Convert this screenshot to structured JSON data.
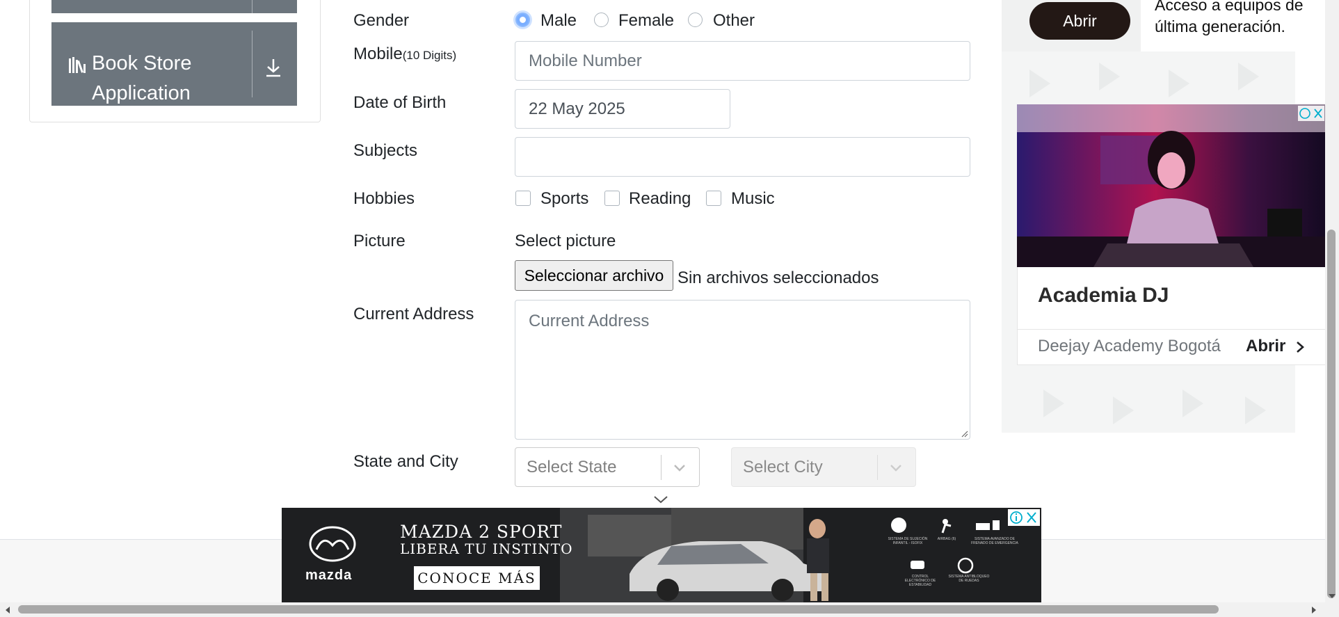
{
  "sidebar": {
    "book_store_label": "Book Store Application"
  },
  "form": {
    "gender": {
      "label": "Gender",
      "options": [
        "Male",
        "Female",
        "Other"
      ],
      "selected": "Male"
    },
    "mobile": {
      "label": "Mobile",
      "hint": "(10 Digits)",
      "placeholder": "Mobile Number",
      "value": ""
    },
    "dob": {
      "label": "Date of Birth",
      "value": "22 May 2025"
    },
    "subjects": {
      "label": "Subjects",
      "value": ""
    },
    "hobbies": {
      "label": "Hobbies",
      "options": [
        "Sports",
        "Reading",
        "Music"
      ],
      "checked": []
    },
    "picture": {
      "label": "Picture",
      "select_text": "Select picture",
      "button_label": "Seleccionar archivo",
      "no_file_text": "Sin archivos seleccionados"
    },
    "address": {
      "label": "Current Address",
      "placeholder": "Current Address",
      "value": ""
    },
    "state_city": {
      "label": "State and City",
      "state_placeholder": "Select State",
      "city_placeholder": "Select City"
    }
  },
  "ad_right": {
    "top_button": "Abrir",
    "top_text_line1": "Acceso a equipos de",
    "top_text_line2": "última generación.",
    "title": "Academia DJ",
    "advertiser": "Deejay Academy Bogotá",
    "cta": "Abrir"
  },
  "banner": {
    "brand": "mazda",
    "headline1": "MAZDA 2 SPORT",
    "headline2": "LIBERA TU INSTINTO",
    "cta": "CONOCE MÁS",
    "feature1": "SISTEMA DE SUJECIÓN INFANTIL - ISOFIX",
    "feature2": "AIRBAG (6)",
    "feature3": "SISTEMA AVANZADO DE FRENADO DE EMERGENCIA",
    "feature4": "CONTROL ELECTRÓNICO DE ESTABILIDAD",
    "feature5": "SISTEMA ANTIBLOQUEO DE RUEDAS"
  },
  "colors": {
    "sidebar_button": "#6c757d",
    "radio_selected": "#7aaeff",
    "ad_pill": "#231815"
  }
}
